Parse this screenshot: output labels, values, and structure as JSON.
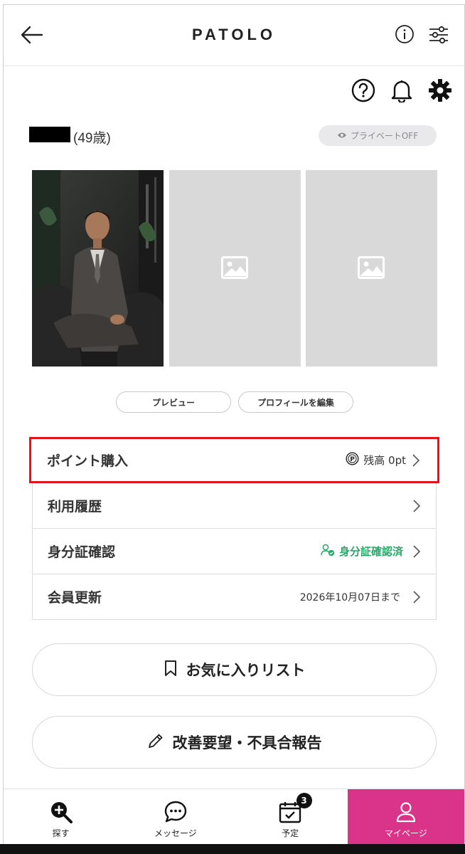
{
  "header": {
    "logo": "PATOLO"
  },
  "profile": {
    "age": "(49歳)",
    "private_status": "プライベートOFF"
  },
  "profile_buttons": {
    "preview": "プレビュー",
    "edit_profile": "プロフィールを編集"
  },
  "menu": {
    "points": {
      "label": "ポイント購入",
      "balance": "残高 0pt"
    },
    "history": {
      "label": "利用履歴"
    },
    "id_verification": {
      "label": "身分証確認",
      "status": "身分証確認済"
    },
    "membership": {
      "label": "会員更新",
      "expiry": "2026年10月07日まで"
    }
  },
  "actions": {
    "favorites": "お気に入りリスト",
    "report": "改善要望・不具合報告"
  },
  "bottom_nav": {
    "search": "探す",
    "messages": "メッセージ",
    "schedule": "予定",
    "schedule_badge": "3",
    "mypage": "マイページ"
  },
  "colors": {
    "accent_pink": "#d9338a",
    "highlight_red": "#e0161c",
    "verified_green": "#2aa86a"
  },
  "icons": [
    "back-arrow-icon",
    "info-icon",
    "filter-icon",
    "help-icon",
    "bell-icon",
    "gear-icon",
    "eye-icon",
    "image-placeholder-icon",
    "point-coin-icon",
    "chevron-right-icon",
    "verified-user-icon",
    "bookmark-icon",
    "pencil-icon",
    "search-plus-icon",
    "chat-bubble-icon",
    "calendar-check-icon",
    "person-icon"
  ]
}
